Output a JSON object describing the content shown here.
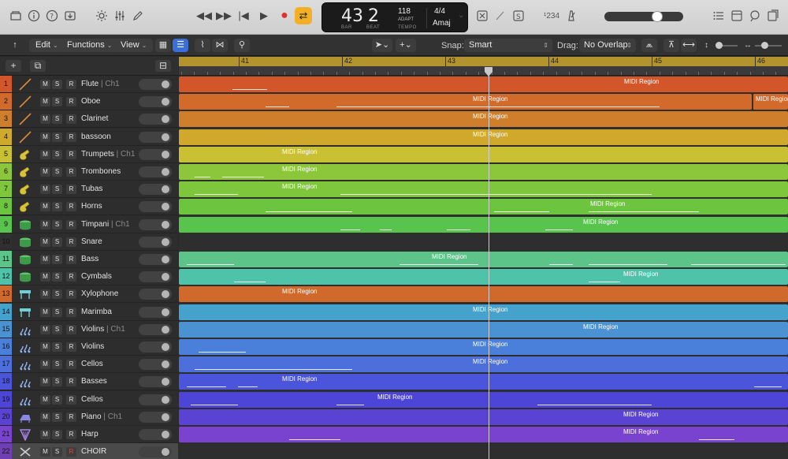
{
  "colors": {
    "loop_accent": "#f3b026",
    "ruler": "#b3932e",
    "tracks": [
      "#d2562a",
      "#d16a2b",
      "#cf7f2b",
      "#cfa82c",
      "#c9c033",
      "#8cc63a",
      "#7ec63b",
      "#6dc43f",
      "#59c44d",
      "#2f2f2f",
      "#5cc489",
      "#4fc3aa",
      "#d06a2c",
      "#45a2cc",
      "#4a92d2",
      "#4a80da",
      "#4c6fdc",
      "#4a55dc",
      "#4d45d8",
      "#5a43d2",
      "#7a43cf",
      "#6f3fb3"
    ]
  },
  "transport": {
    "bar": "43",
    "beat": "2",
    "bar_label": "BAR",
    "beat_label": "BEAT",
    "tempo": "118",
    "adapt": "ADAPT",
    "tempo_label": "TEMPO",
    "signature": "4/4",
    "key": "Amaj",
    "count_in": "¹234"
  },
  "toolbar": {
    "edit": "Edit",
    "functions": "Functions",
    "view": "View",
    "snap_label": "Snap:",
    "snap_value": "Smart",
    "drag_label": "Drag:",
    "drag_value": "No Overlap"
  },
  "ruler": {
    "bars": [
      "41",
      "42",
      "43",
      "44",
      "45",
      "46"
    ]
  },
  "tracks": [
    {
      "num": "1",
      "name": "Flute",
      "ch": " | Ch1",
      "icon": "baton-icon"
    },
    {
      "num": "2",
      "name": "Oboe",
      "ch": "",
      "icon": "baton-icon"
    },
    {
      "num": "3",
      "name": "Clarinet",
      "ch": "",
      "icon": "baton-icon"
    },
    {
      "num": "4",
      "name": "bassoon",
      "ch": "",
      "icon": "baton-icon"
    },
    {
      "num": "5",
      "name": "Trumpets",
      "ch": " | Ch1",
      "icon": "horn-icon"
    },
    {
      "num": "6",
      "name": "Trombones",
      "ch": "",
      "icon": "horn-icon"
    },
    {
      "num": "7",
      "name": "Tubas",
      "ch": "",
      "icon": "horn-icon"
    },
    {
      "num": "8",
      "name": "Horns",
      "ch": "",
      "icon": "horn-icon"
    },
    {
      "num": "9",
      "name": "Timpani",
      "ch": " | Ch1",
      "icon": "drum-icon"
    },
    {
      "num": "10",
      "name": "Snare",
      "ch": "",
      "icon": "drum-icon"
    },
    {
      "num": "11",
      "name": "Bass",
      "ch": "",
      "icon": "drum-icon"
    },
    {
      "num": "12",
      "name": "Cymbals",
      "ch": "",
      "icon": "drum-icon"
    },
    {
      "num": "13",
      "name": "Xylophone",
      "ch": "",
      "icon": "mallet-icon"
    },
    {
      "num": "14",
      "name": "Marimba",
      "ch": "",
      "icon": "mallet-icon"
    },
    {
      "num": "15",
      "name": "Violins",
      "ch": " | Ch1",
      "icon": "strings-icon"
    },
    {
      "num": "16",
      "name": "Violins",
      "ch": "",
      "icon": "strings-icon"
    },
    {
      "num": "17",
      "name": "Cellos",
      "ch": "",
      "icon": "strings-icon"
    },
    {
      "num": "18",
      "name": "Basses",
      "ch": "",
      "icon": "strings-icon"
    },
    {
      "num": "19",
      "name": "Cellos",
      "ch": "",
      "icon": "strings-icon"
    },
    {
      "num": "20",
      "name": "Piano",
      "ch": " | Ch1",
      "icon": "piano-icon"
    },
    {
      "num": "21",
      "name": "Harp",
      "ch": "",
      "icon": "harp-icon"
    },
    {
      "num": "22",
      "name": "CHOIR",
      "ch": "",
      "icon": "choir-icon"
    }
  ],
  "region_label": "MIDI Region"
}
